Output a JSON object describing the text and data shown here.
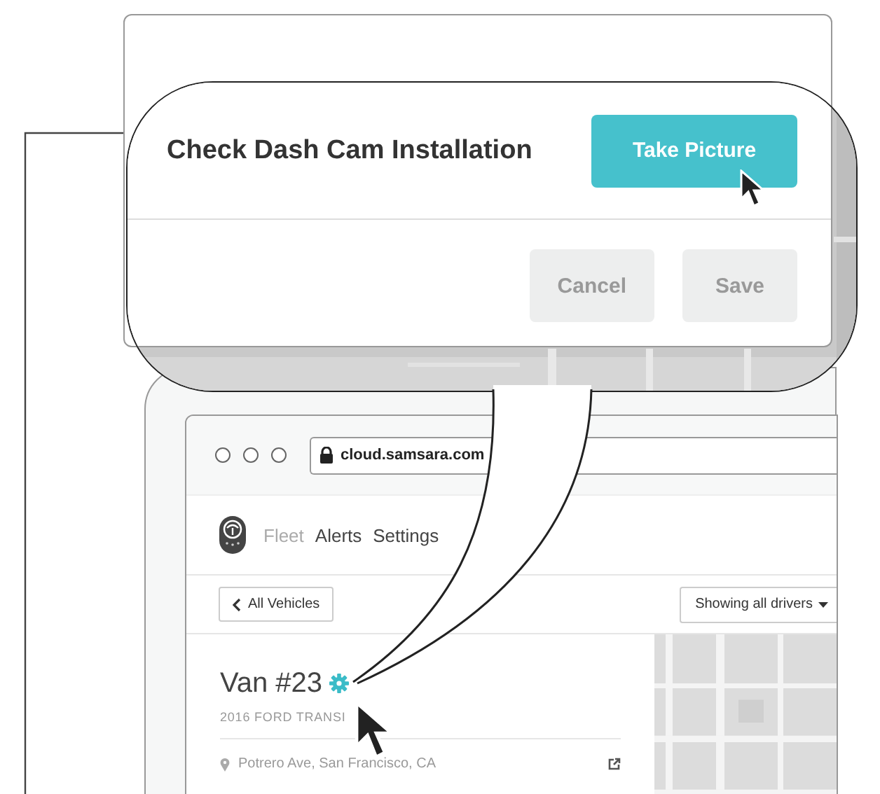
{
  "dialog": {
    "title": "Check Dash Cam Installation",
    "buttons": [
      {
        "label": "Take Picture",
        "kind": "primary"
      },
      {
        "label": "Cancel",
        "kind": "secondary"
      },
      {
        "label": "Save",
        "kind": "secondary"
      }
    ]
  },
  "browser": {
    "url": "cloud.samsara.com"
  },
  "nav": [
    {
      "label": "Fleet",
      "selected": true
    },
    {
      "label": "Alerts",
      "selected": false
    },
    {
      "label": "Settings",
      "selected": false
    }
  ],
  "toolbar": {
    "back": "All Vehicles",
    "filter": "Showing all drivers"
  },
  "vehicle": {
    "name": "Van #23",
    "model": "2016 FORD TRANSI",
    "location": "Potrero Ave, San Francisco, CA"
  }
}
